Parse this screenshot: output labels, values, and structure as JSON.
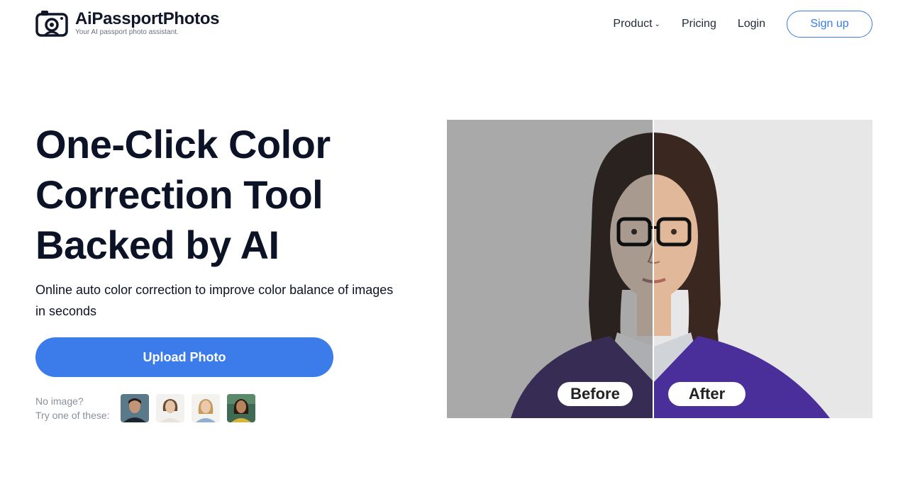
{
  "brand": {
    "name": "AiPassportPhotos",
    "tagline": "Your AI passport photo assistant."
  },
  "nav": {
    "product": "Product",
    "pricing": "Pricing",
    "login": "Login",
    "signup": "Sign up"
  },
  "hero": {
    "title": "One-Click Color Correction Tool Backed by AI",
    "subtitle": "Online auto color correction to improve color balance of images in seconds",
    "upload_button": "Upload Photo",
    "samples_line1": "No image?",
    "samples_line2": "Try one of these:"
  },
  "compare": {
    "before_label": "Before",
    "after_label": "After"
  },
  "colors": {
    "accent": "#3b7bea",
    "text": "#0c1326",
    "muted": "#8a8f99"
  }
}
